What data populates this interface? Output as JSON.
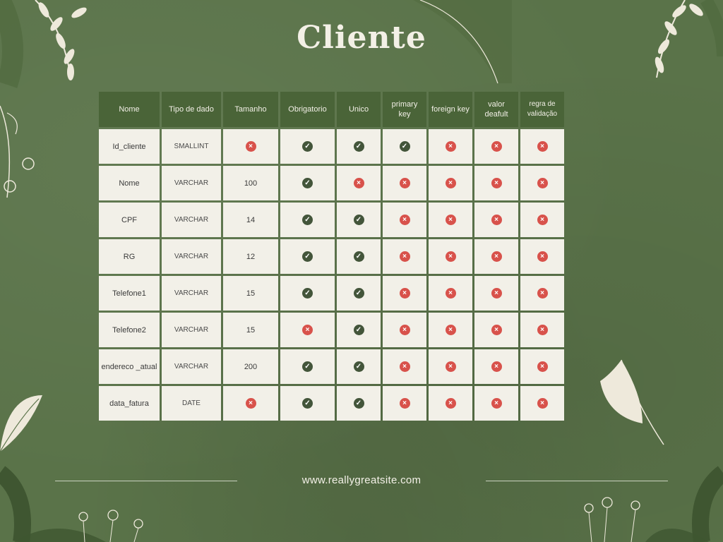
{
  "title": "Cliente",
  "headers": [
    "Nome",
    "Tipo de dado",
    "Tamanho",
    "Obrigatorio",
    "Unico",
    "primary key",
    "foreign key",
    "valor deafult",
    "regra de validação"
  ],
  "rows": [
    {
      "nome": "Id_cliente",
      "tipo": "SMALLINT",
      "tamanho": "",
      "flags": [
        false,
        true,
        true,
        true,
        false,
        false,
        false
      ]
    },
    {
      "nome": "Nome",
      "tipo": "VARCHAR",
      "tamanho": "100",
      "flags": [
        true,
        false,
        false,
        false,
        false,
        false
      ]
    },
    {
      "nome": "CPF",
      "tipo": "VARCHAR",
      "tamanho": "14",
      "flags": [
        true,
        true,
        false,
        false,
        false,
        false
      ]
    },
    {
      "nome": "RG",
      "tipo": "VARCHAR",
      "tamanho": "12",
      "flags": [
        true,
        true,
        false,
        false,
        false,
        false
      ]
    },
    {
      "nome": "Telefone1",
      "tipo": "VARCHAR",
      "tamanho": "15",
      "flags": [
        true,
        true,
        false,
        false,
        false,
        false
      ]
    },
    {
      "nome": "Telefone2",
      "tipo": "VARCHAR",
      "tamanho": "15",
      "flags": [
        false,
        true,
        false,
        false,
        false,
        false
      ]
    },
    {
      "nome": "endereco _atual",
      "tipo": "VARCHAR",
      "tamanho": "200",
      "flags": [
        true,
        true,
        false,
        false,
        false,
        false
      ]
    },
    {
      "nome": "data_fatura",
      "tipo": "DATE",
      "tamanho": "",
      "flags": [
        false,
        true,
        true,
        false,
        false,
        false,
        false
      ]
    }
  ],
  "icons": {
    "check": "check-icon",
    "cross": "cross-icon"
  },
  "colors": {
    "background": "#5a7349",
    "header_cell": "#4a6438",
    "cell": "#f2f0e8",
    "check": "#43553a",
    "cross": "#d8524b"
  },
  "footer_url": "www.reallygreatsite.com"
}
